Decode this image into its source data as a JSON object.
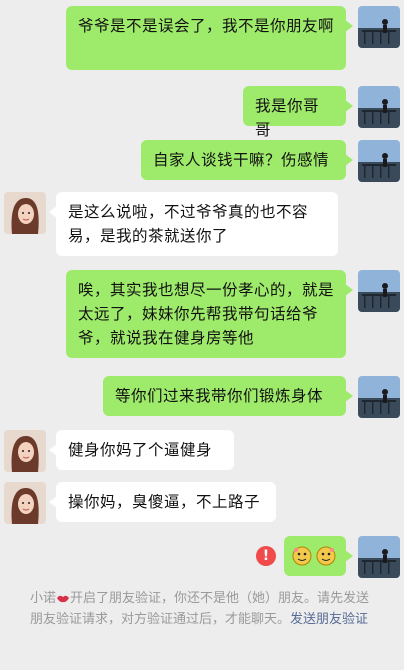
{
  "messages": [
    {
      "from": "me",
      "text": "爷爷是不是误会了，我不是你朋友啊"
    },
    {
      "from": "me",
      "text": "我是你哥哥"
    },
    {
      "from": "me",
      "text": "自家人谈钱干嘛？伤感情"
    },
    {
      "from": "her",
      "text": "是这么说啦，不过爷爷真的也不容易，是我的茶就送你了"
    },
    {
      "from": "me",
      "text": "唉，其实我也想尽一份孝心的，就是太远了，妹妹你先帮我带句话给爷爷，就说我在健身房等他"
    },
    {
      "from": "me",
      "text": "等你们过来我带你们锻炼身体"
    },
    {
      "from": "her",
      "text": "健身你妈了个逼健身"
    },
    {
      "from": "her",
      "text": "操你妈，臭傻逼，不上路子"
    },
    {
      "from": "me",
      "text": "[sticker]",
      "status": "failed"
    }
  ],
  "failed_icon": "!",
  "system_notice": {
    "name": "小诺",
    "body": "开启了朋友验证，你还不是他（她）朋友。请先发送朋友验证请求，对方验证通过后，才能聊天。",
    "link": "发送朋友验证"
  },
  "colors": {
    "me_bubble": "#9eea6a",
    "her_bubble": "#ffffff",
    "link": "#576b95",
    "failed": "#f04a4a"
  }
}
